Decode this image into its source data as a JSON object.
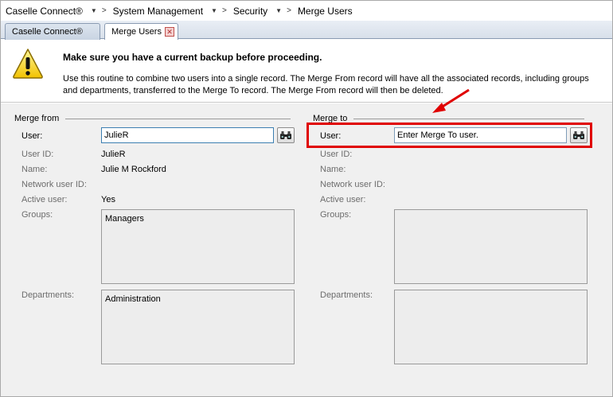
{
  "breadcrumb": {
    "items": [
      "Caselle Connect®",
      "System Management",
      "Security",
      "Merge Users"
    ]
  },
  "tabs": [
    {
      "label": "Caselle Connect®",
      "active": false
    },
    {
      "label": "Merge Users",
      "active": true,
      "close": "✕"
    }
  ],
  "warning": {
    "icon": "warning-triangle-icon",
    "title": "Make sure you have a current backup before proceeding.",
    "text": "Use this routine to combine two users into a single record.  The Merge From record will have all the associated records, including groups and departments, transferred to the Merge To record. The Merge From record will then be deleted."
  },
  "merge_from": {
    "section_label": "Merge from",
    "user_label": "User:",
    "user_value": "JulieR",
    "user_id_label": "User ID:",
    "user_id": "JulieR",
    "name_label": "Name:",
    "name": "Julie M Rockford",
    "network_label": "Network user ID:",
    "network_user_id": "",
    "active_label": "Active user:",
    "active_user": "Yes",
    "groups_label": "Groups:",
    "groups": [
      "Managers"
    ],
    "departments_label": "Departments:",
    "departments": [
      "Administration"
    ]
  },
  "merge_to": {
    "section_label": "Merge to",
    "user_label": "User:",
    "user_value": "Enter Merge To user.",
    "user_id_label": "User ID:",
    "name_label": "Name:",
    "network_label": "Network user ID:",
    "active_label": "Active user:",
    "groups_label": "Groups:",
    "departments_label": "Departments:"
  },
  "colors": {
    "highlight": "#e00000",
    "tab_border": "#8a9bb2",
    "panel_bg": "#f0f0f0"
  }
}
